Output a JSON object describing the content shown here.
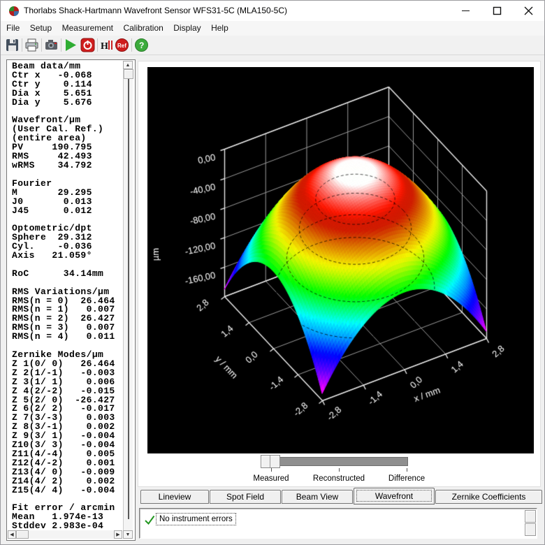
{
  "window": {
    "title": "Thorlabs Shack-Hartmann Wavefront Sensor WFS31-5C (MLA150-5C)",
    "controls": {
      "minimize": "minimize",
      "maximize": "maximize",
      "close": "close"
    }
  },
  "menu": {
    "items": [
      "File",
      "Setup",
      "Measurement",
      "Calibration",
      "Display",
      "Help"
    ]
  },
  "toolbar": {
    "buttons": [
      "save",
      "print",
      "camera",
      "start",
      "stop",
      "reference-wavefront",
      "reference-calibrated",
      "help"
    ]
  },
  "left_panel": {
    "lines": [
      "Beam data/mm",
      "Ctr x   -0.068",
      "Ctr y    0.114",
      "Dia x    5.651",
      "Dia y    5.676",
      "",
      "Wavefront/µm",
      "(User Cal. Ref.)",
      "(entire area)",
      "PV     190.795",
      "RMS     42.493",
      "wRMS    34.792",
      "",
      "Fourier",
      "M       29.295",
      "J0       0.013",
      "J45      0.012",
      "",
      "Optometric/dpt",
      "Sphere  29.312",
      "Cyl.    -0.036",
      "Axis   21.059°",
      "",
      "RoC      34.14mm",
      "",
      "RMS Variations/µm",
      "RMS(n = 0)  26.464",
      "RMS(n = 1)   0.007",
      "RMS(n = 2)  26.427",
      "RMS(n = 3)   0.007",
      "RMS(n = 4)   0.011",
      "",
      "Zernike Modes/µm",
      "Z 1(0/ 0)   26.464",
      "Z 2(1/-1)   -0.003",
      "Z 3(1/ 1)    0.006",
      "Z 4(2/-2)   -0.015",
      "Z 5(2/ 0)  -26.427",
      "Z 6(2/ 2)   -0.017",
      "Z 7(3/-3)    0.003",
      "Z 8(3/-1)    0.002",
      "Z 9(3/ 1)   -0.004",
      "Z10(3/ 3)   -0.004",
      "Z11(4/-4)    0.005",
      "Z12(4/-2)    0.001",
      "Z13(4/ 0)   -0.009",
      "Z14(4/ 2)    0.002",
      "Z15(4/ 4)   -0.004",
      "",
      "Fit error / arcmin",
      "Mean   1.974e-13",
      "Stddev 2.983e-04"
    ]
  },
  "slider": {
    "labels": [
      "Measured",
      "Reconstructed",
      "Difference"
    ],
    "value": "Measured"
  },
  "tabs": {
    "items": [
      "Lineview",
      "Spot Field",
      "Beam View",
      "Wavefront",
      "Zernike Coefficients"
    ],
    "active": "Wavefront"
  },
  "status": {
    "message": "No instrument errors",
    "ok": true,
    "check_color": "#21961f"
  },
  "chart_data": {
    "type": "3d-surface",
    "x": {
      "label": "x / mm",
      "min": -2.8,
      "max": 2.8,
      "ticks": [
        -2.8,
        -1.4,
        0,
        1.4,
        2.8
      ],
      "tick_labels": [
        "-2,8",
        "-1,4",
        "0,0",
        "1,4",
        "2,8"
      ]
    },
    "y": {
      "label": "y / mm",
      "min": -2.8,
      "max": 2.8,
      "ticks": [
        -2.8,
        -1.4,
        0,
        1.4,
        2.8
      ],
      "tick_labels": [
        "-2,8",
        "-1,4",
        "0,0",
        "1,4",
        "2,8"
      ]
    },
    "z": {
      "label": "µm",
      "min": -200,
      "max": 0,
      "ticks": [
        0,
        -40,
        -80,
        -120,
        -160
      ],
      "tick_labels": [
        "0,00",
        "-40,00",
        "-80,00",
        "-120,00",
        "-160,00"
      ]
    },
    "surface": {
      "formula": "z = -a*(x^2+y^2)",
      "a": 12.168,
      "peak_z": 0,
      "pv": 190.795
    },
    "contour_levels": [
      -40,
      -80,
      -120,
      -160
    ],
    "contour_r_scale": 0.64,
    "colormap_hue_stops": [
      [
        0,
        0
      ],
      [
        0.18,
        8
      ],
      [
        0.24,
        30
      ],
      [
        0.3,
        48
      ],
      [
        0.34,
        60
      ],
      [
        0.37,
        70
      ],
      [
        0.45,
        105
      ],
      [
        0.53,
        140
      ],
      [
        0.63,
        185
      ],
      [
        0.7,
        205
      ],
      [
        0.78,
        235
      ],
      [
        0.88,
        262
      ],
      [
        0.95,
        285
      ],
      [
        1,
        306
      ]
    ],
    "highlight": {
      "center_r": 0.6,
      "fade_r": 1.5
    },
    "shadow_band": {
      "r": 1.7,
      "width": 0.5,
      "depth": 9
    },
    "background": "#000000",
    "grid_color": "#9b9b9b",
    "edge_color": "#e8e8e8",
    "label_color": "#ffffff"
  }
}
